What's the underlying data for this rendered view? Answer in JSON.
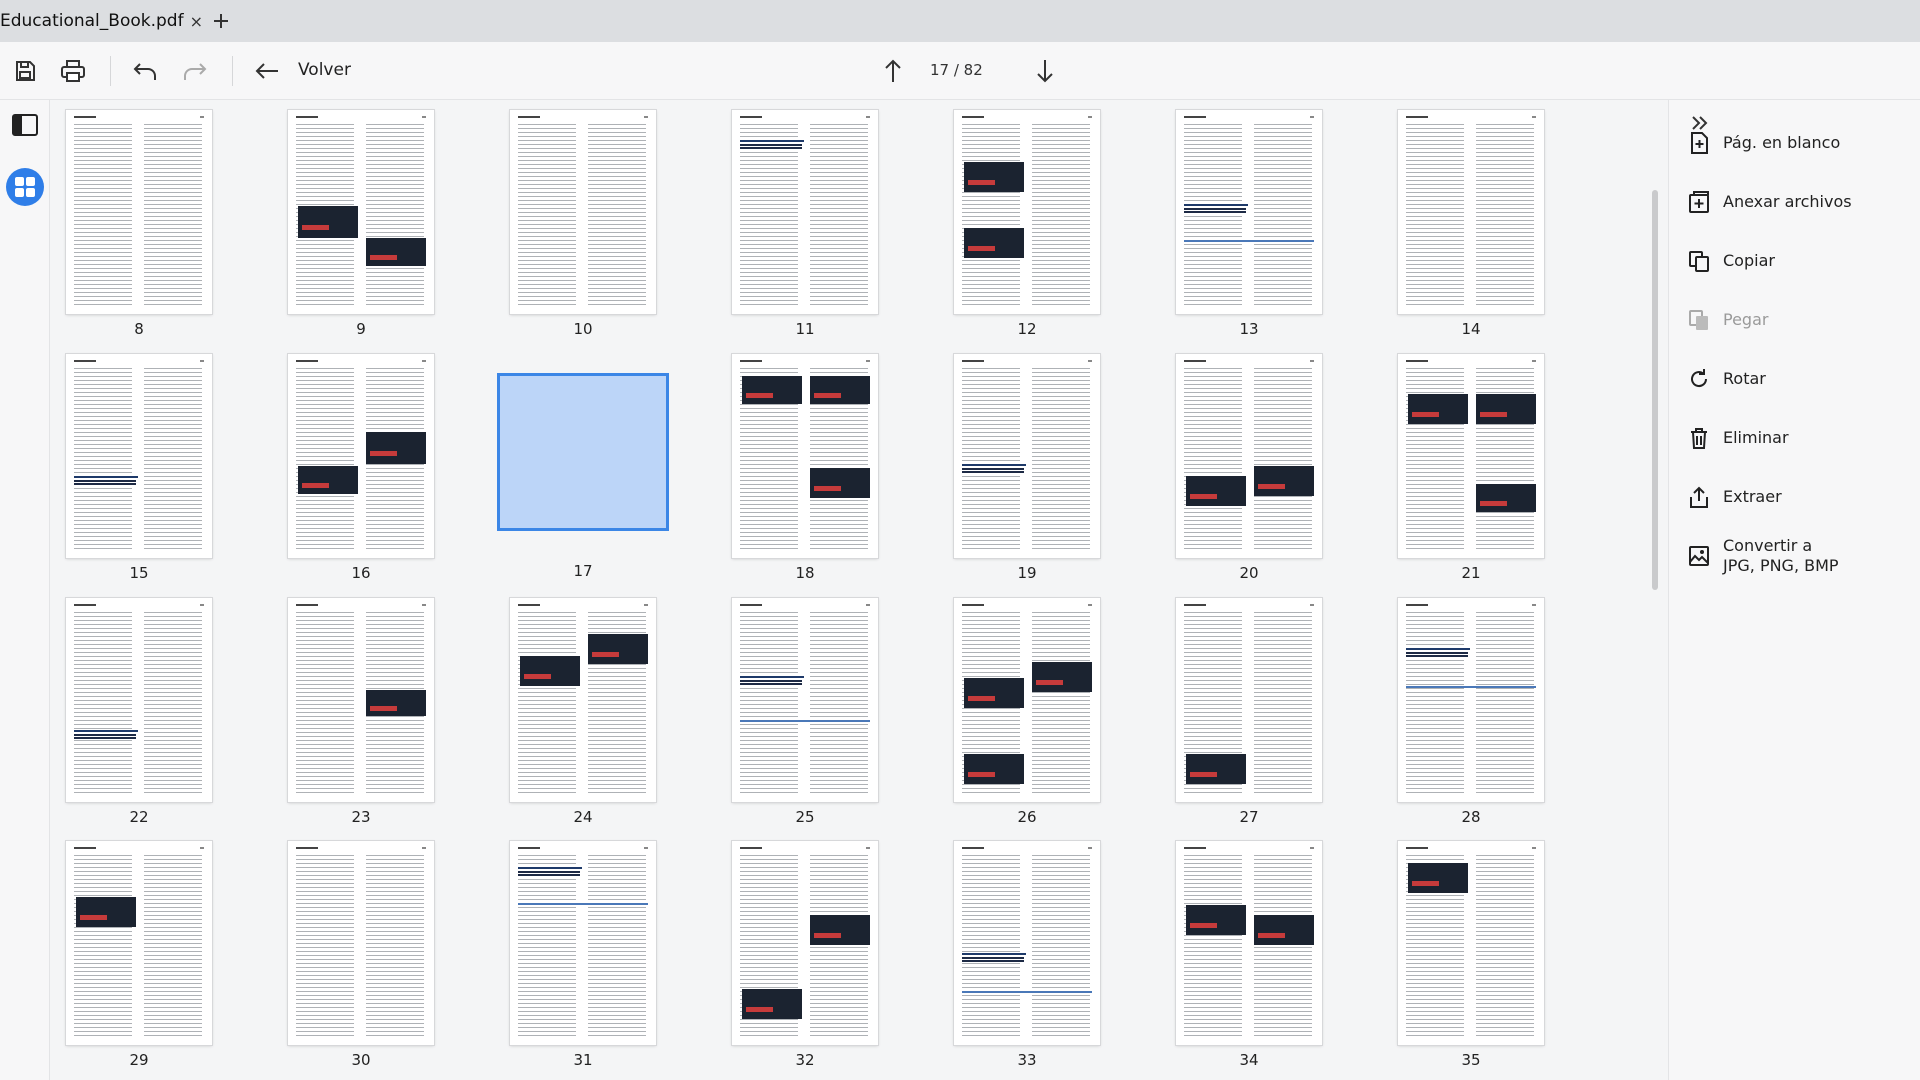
{
  "tab": {
    "title": "Educational_Book.pdf",
    "close": "×"
  },
  "toolbar": {
    "back_label": "Volver",
    "page_indicator": "17 / 82"
  },
  "pages": [
    {
      "label": "8"
    },
    {
      "label": "9"
    },
    {
      "label": "10"
    },
    {
      "label": "11"
    },
    {
      "label": "12"
    },
    {
      "label": "13"
    },
    {
      "label": "14"
    },
    {
      "label": "15"
    },
    {
      "label": "16"
    },
    {
      "label": "17",
      "selected": true
    },
    {
      "label": "18"
    },
    {
      "label": "19"
    },
    {
      "label": "20"
    },
    {
      "label": "21"
    },
    {
      "label": "22"
    },
    {
      "label": "23"
    },
    {
      "label": "24"
    },
    {
      "label": "25"
    },
    {
      "label": "26"
    },
    {
      "label": "27"
    },
    {
      "label": "28"
    },
    {
      "label": "29"
    },
    {
      "label": "30"
    },
    {
      "label": "31"
    },
    {
      "label": "32"
    },
    {
      "label": "33"
    },
    {
      "label": "34"
    },
    {
      "label": "35"
    }
  ],
  "actions": [
    {
      "name": "blank-page",
      "label": "Pág. en blanco",
      "icon": "add-page-icon",
      "enabled": true
    },
    {
      "name": "attach-files",
      "label": "Anexar archivos",
      "icon": "attach-file-icon",
      "enabled": true
    },
    {
      "name": "copy",
      "label": "Copiar",
      "icon": "copy-icon",
      "enabled": true
    },
    {
      "name": "paste",
      "label": "Pegar",
      "icon": "paste-icon",
      "enabled": false
    },
    {
      "name": "rotate",
      "label": "Rotar",
      "icon": "rotate-icon",
      "enabled": true
    },
    {
      "name": "delete",
      "label": "Eliminar",
      "icon": "trash-icon",
      "enabled": true
    },
    {
      "name": "extract",
      "label": "Extraer",
      "icon": "extract-icon",
      "enabled": true
    },
    {
      "name": "convert",
      "label": "Convertir a\nJPG, PNG, BMP",
      "icon": "image-icon",
      "enabled": true
    }
  ],
  "colors": {
    "accent": "#2f7ee8",
    "selected_fill": "#bcd5f8"
  }
}
